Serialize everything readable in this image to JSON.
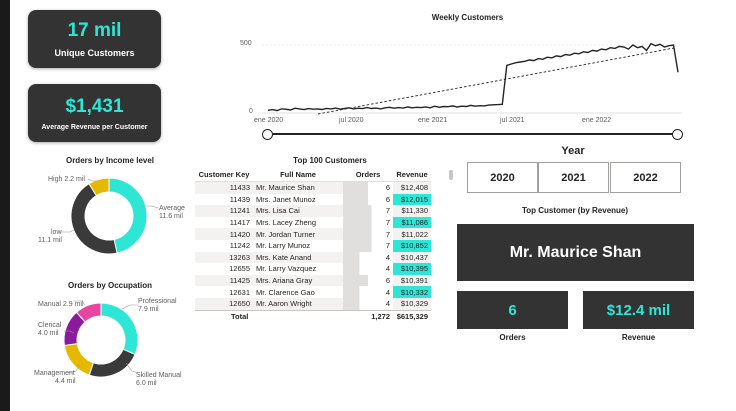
{
  "kpis": {
    "unique_customers": {
      "value": "17 mil",
      "label": "Unique Customers"
    },
    "avg_revenue": {
      "value": "$1,431",
      "label": "Average Revenue per Customer"
    }
  },
  "income_chart": {
    "title": "Orders by Income level",
    "labels": {
      "high": "High 2.2 mil",
      "average": "Average",
      "average_val": "11.6 mil",
      "low": "low",
      "low_val": "11.1 mil"
    }
  },
  "occupation_chart": {
    "title": "Orders by Occupation",
    "labels": {
      "manual": "Manual 2.9 mil",
      "professional": "Professional",
      "professional_val": "7.9 mil",
      "clerical": "Clerical",
      "clerical_val": "4.0 mil",
      "management": "Management",
      "management_val": "4.4 mil",
      "skilled": "Skilled Manual",
      "skilled_val": "6.0 mil"
    }
  },
  "weekly": {
    "title": "Weekly Customers",
    "y_ticks": [
      "500",
      "0"
    ],
    "x_ticks": [
      "ene 2020",
      "jul 2020",
      "ene 2021",
      "jul 2021",
      "ene 2022"
    ]
  },
  "table": {
    "title": "Top 100 Customers",
    "headers": {
      "key": "Customer Key",
      "name": "Full Name",
      "orders": "Orders",
      "revenue": "Revenue"
    },
    "rows": [
      {
        "key": "11433",
        "name": "Mr. Maurice Shan",
        "orders": "6",
        "revenue": "$12,408"
      },
      {
        "key": "11439",
        "name": "Mrs. Janet Munoz",
        "orders": "6",
        "revenue": "$12,015"
      },
      {
        "key": "11241",
        "name": "Mrs. Lisa Cai",
        "orders": "7",
        "revenue": "$11,330"
      },
      {
        "key": "11417",
        "name": "Mrs. Lacey Zheng",
        "orders": "7",
        "revenue": "$11,086"
      },
      {
        "key": "11420",
        "name": "Mr. Jordan Turner",
        "orders": "7",
        "revenue": "$11,022"
      },
      {
        "key": "11242",
        "name": "Mr. Larry Munoz",
        "orders": "7",
        "revenue": "$10,852"
      },
      {
        "key": "13263",
        "name": "Mrs. Kate Anand",
        "orders": "4",
        "revenue": "$10,437"
      },
      {
        "key": "12655",
        "name": "Mr. Larry Vazquez",
        "orders": "4",
        "revenue": "$10,395"
      },
      {
        "key": "11425",
        "name": "Mrs. Ariana Gray",
        "orders": "6",
        "revenue": "$10,391"
      },
      {
        "key": "12631",
        "name": "Mr. Clarence Gao",
        "orders": "4",
        "revenue": "$10,332"
      },
      {
        "key": "12650",
        "name": "Mr. Aaron Wright",
        "orders": "4",
        "revenue": "$10,329"
      }
    ],
    "total": {
      "label": "Total",
      "orders": "1,272",
      "revenue": "$615,329"
    }
  },
  "year_slicer": {
    "title": "Year",
    "options": [
      "2020",
      "2021",
      "2022"
    ]
  },
  "top_customer": {
    "title": "Top Customer (by Revenue)",
    "name": "Mr. Maurice Shan",
    "orders": "6",
    "orders_label": "Orders",
    "revenue": "$12.4 mil",
    "revenue_label": "Revenue"
  },
  "colors": {
    "teal": "#2ee6d6",
    "dark": "#333333",
    "yellow": "#e6b800",
    "purple": "#8b1a9c",
    "pink": "#e645a0",
    "gray": "#3a3a3a"
  },
  "chart_data": [
    {
      "type": "pie",
      "title": "Orders by Income level",
      "categories": [
        "Average",
        "low",
        "High"
      ],
      "values": [
        11.6,
        11.1,
        2.2
      ]
    },
    {
      "type": "pie",
      "title": "Orders by Occupation",
      "categories": [
        "Professional",
        "Skilled Manual",
        "Management",
        "Clerical",
        "Manual"
      ],
      "values": [
        7.9,
        6.0,
        4.4,
        4.0,
        2.9
      ]
    },
    {
      "type": "line",
      "title": "Weekly Customers",
      "ylim": [
        0,
        600
      ],
      "x_labels": [
        "ene 2020",
        "jul 2020",
        "ene 2021",
        "jul 2021",
        "ene 2022"
      ],
      "series": [
        {
          "values": [
            20,
            25,
            18,
            30,
            28,
            22,
            35,
            30,
            25,
            32,
            28,
            30,
            26,
            34,
            30,
            36,
            28,
            33,
            38,
            30,
            35,
            32,
            40,
            33,
            36,
            30,
            38,
            42,
            35,
            40,
            36,
            44,
            38,
            42,
            40,
            45,
            38,
            50,
            42,
            48,
            46,
            52,
            44,
            50,
            48,
            56,
            50,
            54,
            52,
            58,
            60,
            62,
            64,
            350,
            360,
            370,
            375,
            380,
            390,
            385,
            400,
            395,
            410,
            405,
            420,
            415,
            430,
            425,
            440,
            435,
            450,
            445,
            460,
            455,
            470,
            465,
            480,
            475,
            490,
            485,
            470,
            500,
            480,
            490,
            460,
            510,
            495,
            505,
            485,
            495,
            500,
            300
          ]
        }
      ]
    }
  ]
}
